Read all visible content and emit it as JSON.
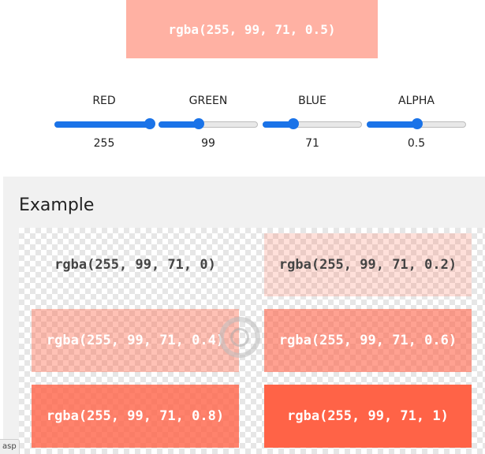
{
  "swatch": {
    "label": "rgba(255, 99, 71, 0.5)",
    "color": "rgba(255, 99, 71, 0.5)"
  },
  "sliders": [
    {
      "label": "RED",
      "value": "255",
      "fraction": 1.0
    },
    {
      "label": "GREEN",
      "value": "99",
      "fraction": 0.388
    },
    {
      "label": "BLUE",
      "value": "71",
      "fraction": 0.278
    },
    {
      "label": "ALPHA",
      "value": "0.5",
      "fraction": 0.5
    }
  ],
  "accent_color": "#1a73e8",
  "example": {
    "title": "Example",
    "boxes": [
      {
        "label": "rgba(255, 99, 71, 0)",
        "color": "rgba(255, 99, 71, 0)",
        "text_color": "#444444"
      },
      {
        "label": "rgba(255, 99, 71, 0.2)",
        "color": "rgba(255, 99, 71, 0.2)",
        "text_color": "#444444"
      },
      {
        "label": "rgba(255, 99, 71, 0.4)",
        "color": "rgba(255, 99, 71, 0.4)",
        "text_color": "#ffffff"
      },
      {
        "label": "rgba(255, 99, 71, 0.6)",
        "color": "rgba(255, 99, 71, 0.6)",
        "text_color": "#ffffff"
      },
      {
        "label": "rgba(255, 99, 71, 0.8)",
        "color": "rgba(255, 99, 71, 0.8)",
        "text_color": "#ffffff"
      },
      {
        "label": "rgba(255, 99, 71, 1)",
        "color": "rgba(255, 99, 71, 1)",
        "text_color": "#ffffff"
      }
    ]
  },
  "status_tip": "asp",
  "loader_icon": "spinner-icon"
}
